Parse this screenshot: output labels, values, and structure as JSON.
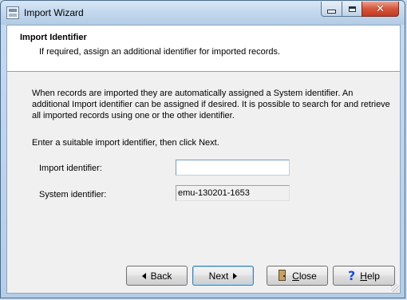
{
  "window": {
    "title": "Import Wizard",
    "controls": {
      "minimize_icon": "minimize-icon",
      "maximize_icon": "maximize-icon",
      "close_glyph": "✕"
    }
  },
  "header": {
    "title": "Import Identifier",
    "subtitle": "If required, assign an additional identifier for imported records."
  },
  "body": {
    "description": "When records are imported they are automatically assigned a System identifier. An additional Import identifier can be assigned if desired. It is possible to search for and retrieve all imported records using one or the other identifier.",
    "instruction": "Enter a suitable import identifier, then click Next.",
    "import_identifier": {
      "label": "Import identifier:",
      "value": ""
    },
    "system_identifier": {
      "label": "System identifier:",
      "value": "emu-130201-1653"
    }
  },
  "buttons": {
    "back": "Back",
    "next": "Next",
    "close": {
      "first": "C",
      "rest": "lose"
    },
    "help": {
      "first": "H",
      "rest": "elp"
    }
  }
}
